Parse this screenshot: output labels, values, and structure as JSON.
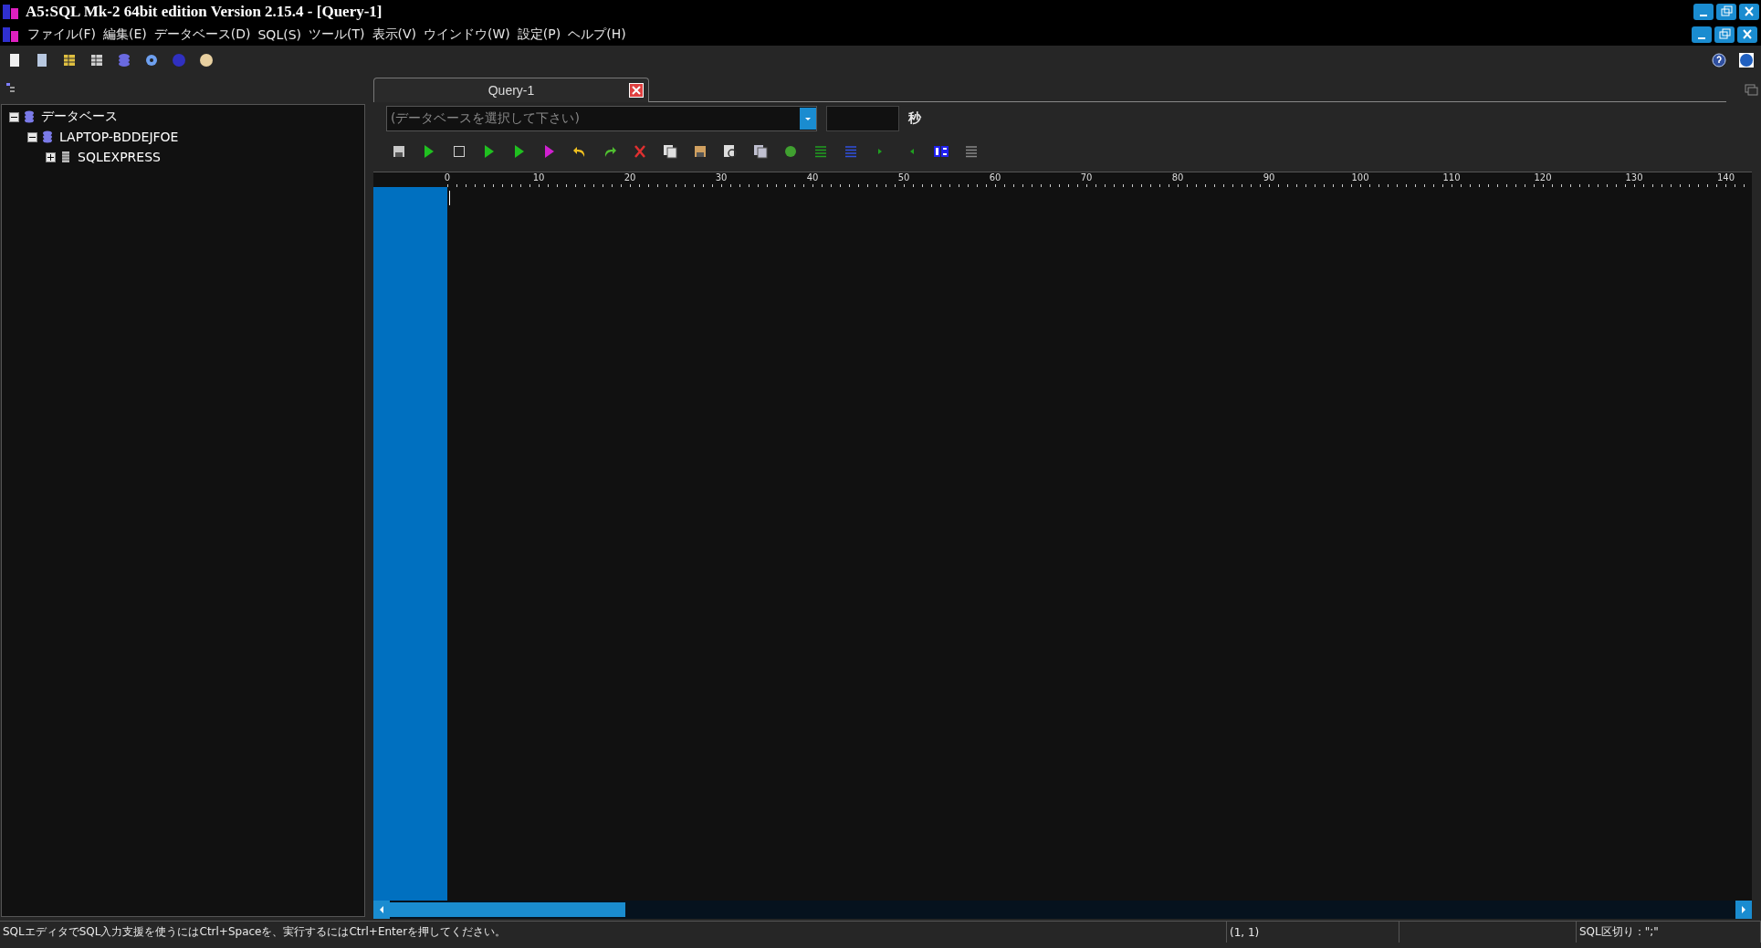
{
  "window": {
    "title": "A5:SQL Mk-2 64bit edition Version 2.15.4 - [Query-1]"
  },
  "menu": [
    "ファイル(F)",
    "編集(E)",
    "データベース(D)",
    "SQL(S)",
    "ツール(T)",
    "表示(V)",
    "ウインドウ(W)",
    "設定(P)",
    "ヘルプ(H)"
  ],
  "tree": [
    {
      "label": "データベース",
      "expanded": true,
      "children": [
        {
          "label": "LAPTOP-BDDEJFOE",
          "expanded": true,
          "children": [
            {
              "label": "SQLEXPRESS",
              "expanded": false
            }
          ]
        }
      ]
    }
  ],
  "tabs": [
    {
      "label": "Query-1",
      "selected": true
    }
  ],
  "database_select": {
    "placeholder": "(データベースを選択して下さい)"
  },
  "timeout": {
    "unit": "秒"
  },
  "ruler": {
    "labels": [
      "0",
      "10",
      "20",
      "30",
      "40",
      "50",
      "60",
      "70",
      "80",
      "90",
      "100",
      "110",
      "120",
      "130",
      "140"
    ]
  },
  "status_bar": {
    "message": "SQLエディタでSQL入力支援を使うにはCtrl+Spaceを、実行するにはCtrl+Enterを押してください。",
    "position": "(1, 1)",
    "delimiter": "SQL区切り：\";\""
  }
}
